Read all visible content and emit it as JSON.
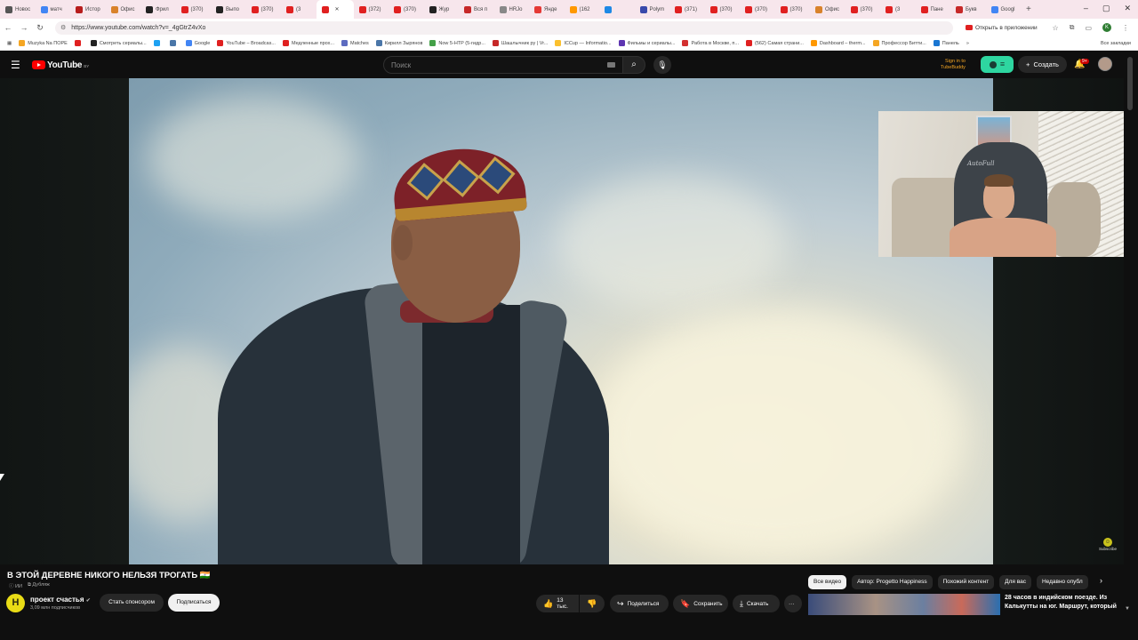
{
  "browser": {
    "tabs": [
      {
        "label": "Новос",
        "color": "#555555"
      },
      {
        "label": "матч",
        "color": "#4285f4"
      },
      {
        "label": "Истор",
        "color": "#b71c1c"
      },
      {
        "label": "Офис",
        "color": "#d9822b"
      },
      {
        "label": "Фрил",
        "color": "#222222"
      },
      {
        "label": "(370)",
        "color": "#e02020"
      },
      {
        "label": "Выпо",
        "color": "#222222"
      },
      {
        "label": "(370)",
        "color": "#e02020"
      },
      {
        "label": "(3",
        "color": "#e02020"
      },
      {
        "label": "",
        "color": "#e02020",
        "active": true
      },
      {
        "label": "(372)",
        "color": "#e02020"
      },
      {
        "label": "(370)",
        "color": "#e02020"
      },
      {
        "label": "Жур",
        "color": "#222222"
      },
      {
        "label": "Вся п",
        "color": "#c62828"
      },
      {
        "label": "HRJo",
        "color": "#888888"
      },
      {
        "label": "Янде",
        "color": "#e53935"
      },
      {
        "label": "(162",
        "color": "#ff9800"
      },
      {
        "label": "",
        "color": "#1e88e5"
      },
      {
        "label": "Polym",
        "color": "#3949ab"
      },
      {
        "label": "(371)",
        "color": "#e02020"
      },
      {
        "label": "(370)",
        "color": "#e02020"
      },
      {
        "label": "(370)",
        "color": "#e02020"
      },
      {
        "label": "(370)",
        "color": "#e02020"
      },
      {
        "label": "Офис",
        "color": "#d9822b"
      },
      {
        "label": "(370)",
        "color": "#e02020"
      },
      {
        "label": "(3",
        "color": "#e02020"
      },
      {
        "label": "Пане",
        "color": "#e02020"
      },
      {
        "label": "Букв",
        "color": "#c62828"
      },
      {
        "label": "Googl",
        "color": "#4285f4"
      }
    ],
    "new_tab": "+",
    "window_controls": [
      "–",
      "▢",
      "✕"
    ],
    "url": "https://www.youtube.com/watch?v=_4gGtrZ4vXo",
    "open_in_app": "Открыть в приложении",
    "account_letter": "K",
    "bookmarks": [
      {
        "label": "Muzyka Na ПОРЕ",
        "color": "#f5a623"
      },
      {
        "label": "",
        "color": "#e02020"
      },
      {
        "label": "Смотреть сериалы...",
        "color": "#222222"
      },
      {
        "label": "",
        "color": "#1da1f2"
      },
      {
        "label": "",
        "color": "#4a76a8"
      },
      {
        "label": "Google",
        "color": "#4285f4"
      },
      {
        "label": "YouTube – Broadcas...",
        "color": "#e02020"
      },
      {
        "label": "Медленные прох...",
        "color": "#e02020"
      },
      {
        "label": "Matches",
        "color": "#5c6bc0"
      },
      {
        "label": "Кирилл Зырянов",
        "color": "#4a76a8"
      },
      {
        "label": "Now 5-HTP (5-гидр...",
        "color": "#43a047"
      },
      {
        "label": "Шашлычник ру | Vr...",
        "color": "#c62828"
      },
      {
        "label": "ICCup — Informatio...",
        "color": "#fbc02d"
      },
      {
        "label": "Фильмы и сериалы...",
        "color": "#5e35b1"
      },
      {
        "label": "Работа в Москве, п...",
        "color": "#d32f2f"
      },
      {
        "label": "(562) Самая страни...",
        "color": "#e02020"
      },
      {
        "label": "Dashboard – therm...",
        "color": "#ff9800"
      },
      {
        "label": "Профессор Битти...",
        "color": "#f5a623"
      },
      {
        "label": "Панель",
        "color": "#1976d2"
      }
    ],
    "bookmarks_more": "»",
    "all_bookmarks": "Все закладки"
  },
  "youtube": {
    "logo_text": "YouTube",
    "country": "BY",
    "search_placeholder": "Поиск",
    "tubebuddy_signin": "Sign in to",
    "tubebuddy_name": "TubeBuddy",
    "create_label": "Создать",
    "notif_badge": "9+",
    "watermark_label": "Subscribe"
  },
  "video": {
    "title": "В ЭТОЙ ДЕРЕВНЕ НИКОГО НЕЛЬЗЯ ТРОГАТЬ 🇮🇳",
    "tag_ai": "ИИ",
    "tag_dub": "Дубляж",
    "channel_initial": "H",
    "channel_name": "проект счастья",
    "subscribers": "3,09 млн подписчиков",
    "sponsor_label": "Стать спонсором",
    "subscribe_label": "Подписаться",
    "likes": "13 тыс.",
    "share_label": "Поделиться",
    "save_label": "Сохранить",
    "download_label": "Скачать",
    "more_label": "···"
  },
  "recommendations": {
    "chips": [
      "Все видео",
      "Автор: Progetto Happiness",
      "Похожий контент",
      "Для вас",
      "Недавно опубл"
    ],
    "next_arrow": "›",
    "first_title": "28 часов в индийском поезде. Из Калькутты на юг. Маршрут, который"
  },
  "webcam_text": "AutoFull"
}
